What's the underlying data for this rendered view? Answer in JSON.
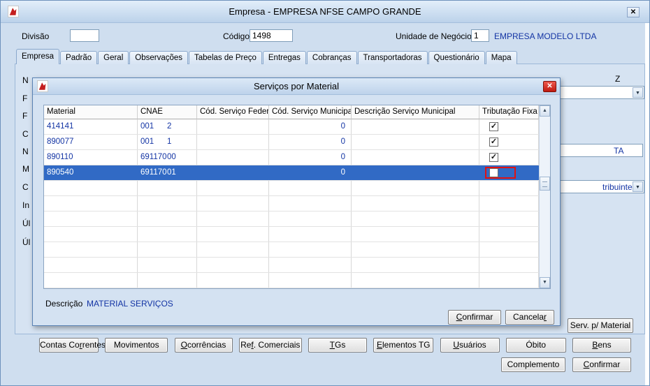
{
  "icons": {
    "close": "✕",
    "check": "✓",
    "scroll_up": "▲",
    "scroll_down": "▼",
    "combo_arrow": "▼"
  },
  "colors": {
    "selection": "#316ac5",
    "data_text": "#1334a4",
    "annotation": "#e01212"
  },
  "window": {
    "title": "Empresa - EMPRESA NFSE CAMPO GRANDE"
  },
  "form": {
    "divisao_label": "Divisão",
    "divisao_value": "",
    "codigo_label": "Código",
    "codigo_value": "1498",
    "unidade_label": "Unidade de Negócio",
    "unidade_value": "1",
    "unidade_empresa": "EMPRESA MODELO LTDA"
  },
  "tabs": [
    {
      "label": "Empresa",
      "active": true
    },
    {
      "label": "Padrão",
      "active": false
    },
    {
      "label": "Geral",
      "active": false
    },
    {
      "label": "Observações",
      "active": false
    },
    {
      "label": "Tabelas de Preço",
      "active": false
    },
    {
      "label": "Entregas",
      "active": false
    },
    {
      "label": "Cobranças",
      "active": false
    },
    {
      "label": "Transportadoras",
      "active": false
    },
    {
      "label": "Questionário",
      "active": false
    },
    {
      "label": "Mapa",
      "active": false
    }
  ],
  "panel_fragments": {
    "left": [
      "N",
      "F",
      "F",
      "C",
      "N",
      "M",
      "C",
      "In",
      "Úl",
      "Úl"
    ],
    "right_top": "Z",
    "right_field": "TA",
    "right_combo": "tribuinte",
    "serv_material_button": {
      "text": "Serv. p/ Material"
    }
  },
  "modal": {
    "title": "Serviços por Material",
    "table": {
      "columns": [
        "Material",
        "CNAE",
        "Cód. Serviço Federal",
        "Cód. Serviço Municipal",
        "Descrição Serviço Municipal",
        "Tributação Fixa"
      ],
      "rows": [
        {
          "material": "414141",
          "cnae": "001",
          "cnae_sub": "2",
          "cod_servico_federal": "",
          "cod_servico_municipal": "0",
          "descricao_servico_municipal": "",
          "tributacao_fixa": true,
          "selected": false,
          "annotated": false
        },
        {
          "material": "890077",
          "cnae": "001",
          "cnae_sub": "1",
          "cod_servico_federal": "",
          "cod_servico_municipal": "0",
          "descricao_servico_municipal": "",
          "tributacao_fixa": true,
          "selected": false,
          "annotated": false
        },
        {
          "material": "890110",
          "cnae": "691170",
          "cnae_sub": "00",
          "cod_servico_federal": "",
          "cod_servico_municipal": "0",
          "descricao_servico_municipal": "",
          "tributacao_fixa": true,
          "selected": false,
          "annotated": false
        },
        {
          "material": "890540",
          "cnae": "691170",
          "cnae_sub": "01",
          "cod_servico_federal": "",
          "cod_servico_municipal": "0",
          "descricao_servico_municipal": "",
          "tributacao_fixa": false,
          "selected": true,
          "annotated": true
        }
      ],
      "empty_rows": 7
    },
    "descricao_label": "Descrição",
    "descricao_value": "MATERIAL SERVIÇOS",
    "confirm_button": {
      "text": "Confirmar",
      "u": 0
    },
    "cancel_button": {
      "text": "Cancelar",
      "u": 7
    }
  },
  "bottom_row1": [
    {
      "text": "Contas Correntes",
      "u": 9
    },
    {
      "text": "Movimentos"
    },
    {
      "text": "Ocorrências",
      "u": 0
    },
    {
      "text": "Ref. Comerciais",
      "u": 2
    },
    {
      "text": "TGs",
      "u": 0
    },
    {
      "text": "Elementos TG",
      "u": 0
    },
    {
      "text": "Usuários",
      "u": 0
    },
    {
      "text": "Óbito"
    },
    {
      "text": "Bens",
      "u": 0
    }
  ],
  "bottom_row2": [
    {
      "text": "Complemento"
    },
    {
      "text": "Confirmar",
      "u": 0
    }
  ]
}
